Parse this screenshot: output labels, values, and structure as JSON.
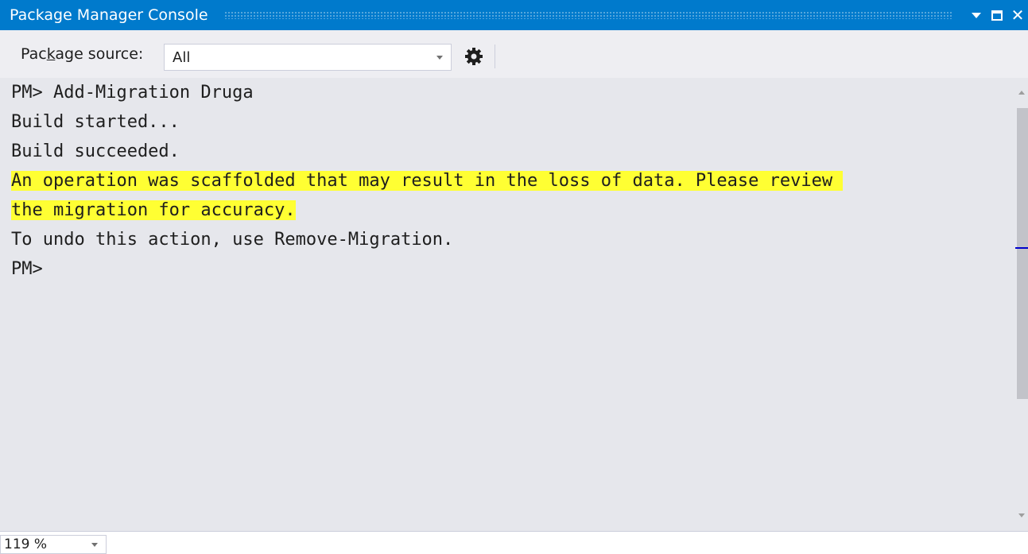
{
  "window": {
    "title": "Package Manager Console",
    "accent_color": "#007ACC",
    "buttons": {
      "dropdown_icon": "triangle-down-icon",
      "maximize_icon": "maximize-icon",
      "close_icon": "close-icon",
      "close_glyph": "✕"
    }
  },
  "toolbar": {
    "source_label_pre": "Pac",
    "source_label_key": "k",
    "source_label_post": "age source:",
    "source_value": "All",
    "settings_icon": "gear-icon"
  },
  "console": {
    "highlight_color": "#FFFF33",
    "lines": [
      {
        "text": "PM> Add-Migration Druga",
        "highlight": false
      },
      {
        "text": "Build started...",
        "highlight": false
      },
      {
        "text": "Build succeeded.",
        "highlight": false
      },
      {
        "text": "An operation was scaffolded that may result in the loss of data. Please review ",
        "highlight": true
      },
      {
        "text": "the migration for accuracy.",
        "highlight": true
      },
      {
        "text": "To undo this action, use Remove-Migration.",
        "highlight": false
      },
      {
        "text": "PM>",
        "highlight": false
      }
    ]
  },
  "status": {
    "zoom_level": "119 %"
  }
}
